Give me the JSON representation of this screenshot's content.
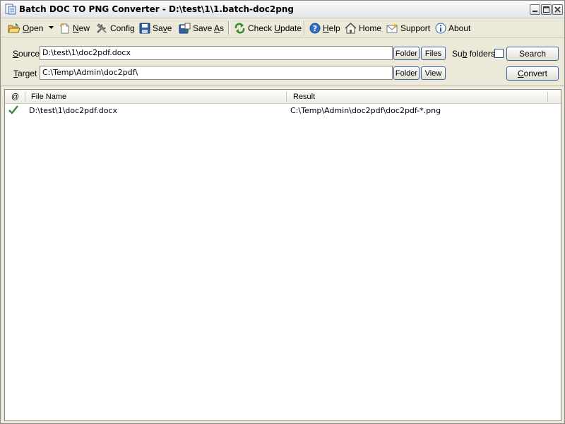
{
  "window": {
    "title": "Batch DOC TO PNG Converter - D:\\test\\1\\1.batch-doc2png"
  },
  "toolbar": {
    "open": {
      "pre": "",
      "u": "O",
      "post": "pen"
    },
    "new": {
      "pre": "",
      "u": "N",
      "post": "ew"
    },
    "config": {
      "pre": "Config",
      "u": "",
      "post": ""
    },
    "save": {
      "pre": "Sa",
      "u": "v",
      "post": "e"
    },
    "save_as": {
      "pre": "Save ",
      "u": "A",
      "post": "s"
    },
    "check_update": {
      "pre": "Check ",
      "u": "U",
      "post": "pdate"
    },
    "help": {
      "pre": "",
      "u": "H",
      "post": "elp"
    },
    "home": {
      "pre": "Home",
      "u": "",
      "post": ""
    },
    "support": {
      "pre": "Support",
      "u": "",
      "post": ""
    },
    "about": {
      "pre": "About",
      "u": "",
      "post": ""
    }
  },
  "paths": {
    "source": {
      "label_u": "S",
      "label_rest": "ource",
      "value": "D:\\test\\1\\doc2pdf.docx",
      "folder_btn": "Folder",
      "files_btn": "Files"
    },
    "target": {
      "label_u": "T",
      "label_rest": "arget",
      "value": "C:\\Temp\\Admin\\doc2pdf\\",
      "folder_btn": "Folder",
      "view_btn": "View"
    },
    "subfolders": {
      "pre": "Su",
      "u": "b",
      "post": " folders",
      "checked": false
    },
    "search_btn": "Search",
    "convert_btn": {
      "pre": "",
      "u": "C",
      "post": "onvert"
    }
  },
  "list": {
    "columns": {
      "status": "@",
      "file_name": "File Name",
      "result": "Result"
    },
    "rows": [
      {
        "status_icon": "check-icon",
        "file_name": "D:\\test\\1\\doc2pdf.docx",
        "result": "C:\\Temp\\Admin\\doc2pdf\\doc2pdf-*.png"
      }
    ]
  },
  "colors": {
    "check": "#3a8a3a",
    "accent": "#3d5ea3"
  }
}
